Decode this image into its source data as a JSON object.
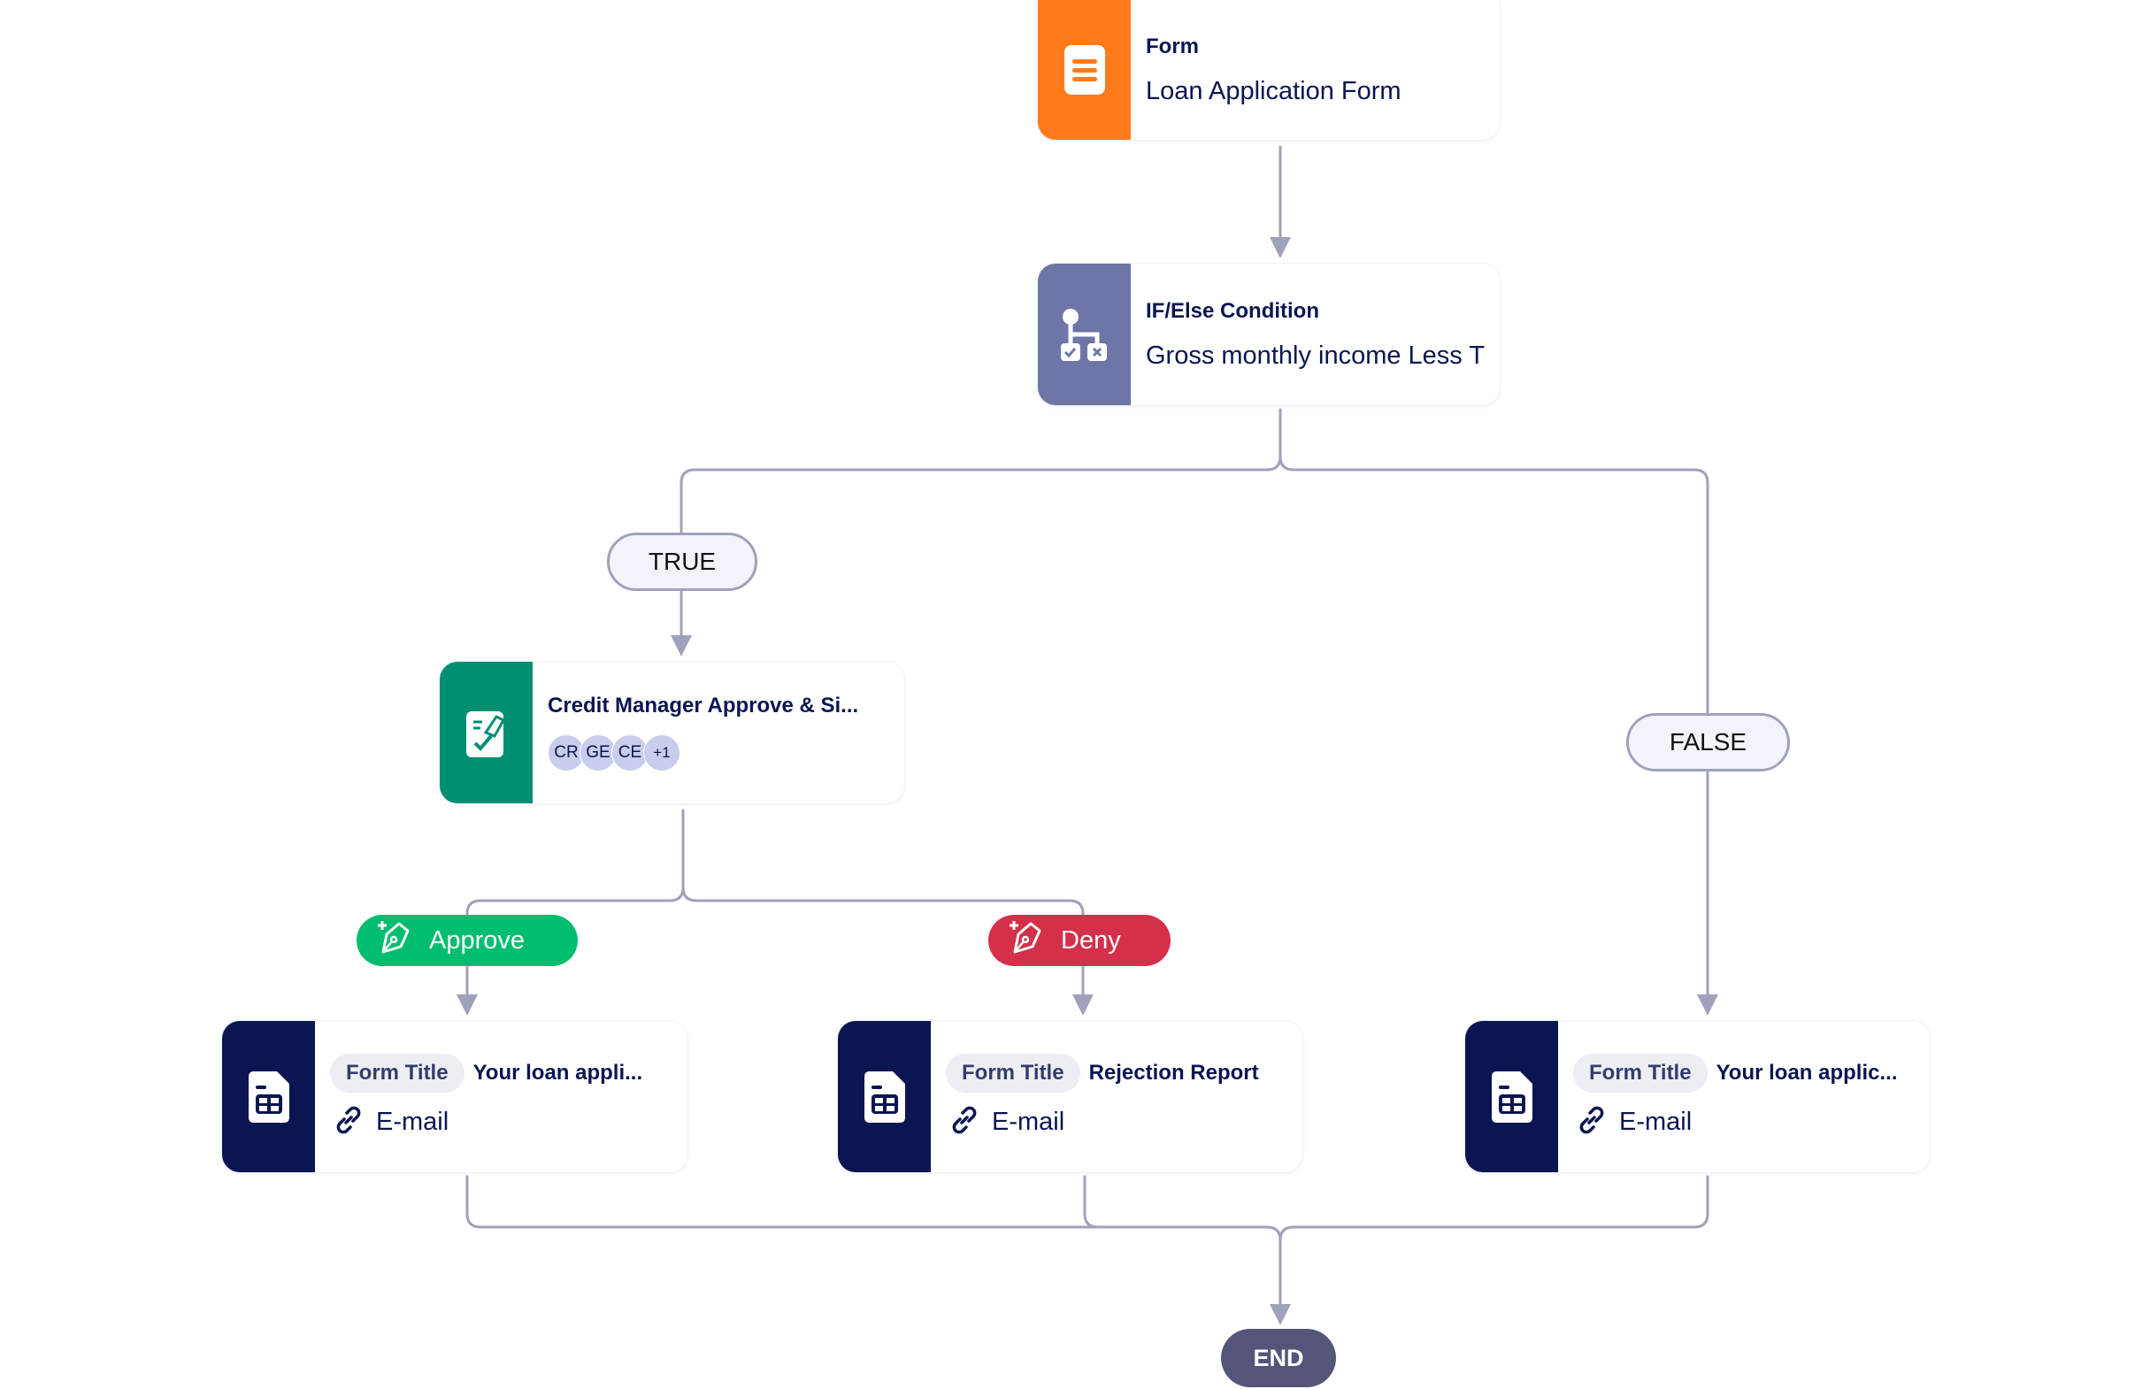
{
  "colors": {
    "connector": "#a0a1bb",
    "form_panel": "#ff7b1c",
    "condition_panel": "#6e76a8",
    "approval_panel": "#018f73",
    "output_panel": "#0a1551",
    "approve": "#01bd6f",
    "deny": "#d4304a",
    "end": "#55557a",
    "text": "#0a1551"
  },
  "nodes": {
    "form": {
      "type_label": "Form",
      "name": "Loan Application Form",
      "icon": "form-document-icon"
    },
    "condition": {
      "type_label": "IF/Else Condition",
      "name": "Gross monthly income Less T",
      "icon": "branch-condition-icon"
    },
    "approval": {
      "type_label": "Credit Manager Approve & Si...",
      "icon": "sign-document-icon",
      "assignees": [
        "CR",
        "GE",
        "CE"
      ],
      "more_count": "+1"
    },
    "outputs": [
      {
        "chip": "Form Title",
        "title": "Your loan appli...",
        "channel": "E-mail",
        "icon": "pdf-table-document-icon",
        "channel_icon": "link-icon"
      },
      {
        "chip": "Form Title",
        "title": "Rejection Report",
        "channel": "E-mail",
        "icon": "pdf-table-document-icon",
        "channel_icon": "link-icon"
      },
      {
        "chip": "Form Title",
        "title": "Your loan applic...",
        "channel": "E-mail",
        "icon": "pdf-table-document-icon",
        "channel_icon": "link-icon"
      }
    ]
  },
  "branches": {
    "true_label": "TRUE",
    "false_label": "FALSE"
  },
  "actions": {
    "approve_label": "Approve",
    "deny_label": "Deny",
    "icon": "pen-plus-icon"
  },
  "end_label": "END"
}
